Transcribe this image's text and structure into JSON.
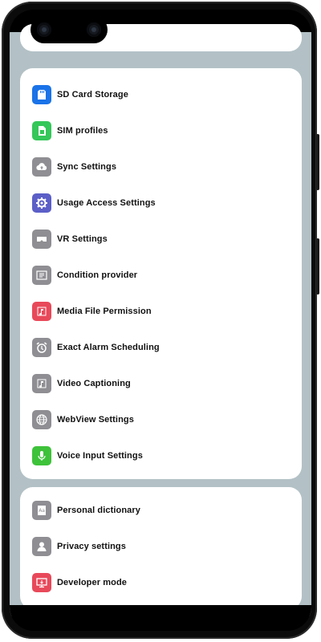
{
  "group1": {
    "items": [
      {
        "label": "SD Card Storage",
        "icon": "sd-card-icon",
        "color": "#1a73e8"
      },
      {
        "label": "SIM profiles",
        "icon": "sim-icon",
        "color": "#34c759"
      },
      {
        "label": "Sync Settings",
        "icon": "cloud-sync-icon",
        "color": "#8e8e93"
      },
      {
        "label": "Usage Access Settings",
        "icon": "gear-icon",
        "color": "#5b5fc7"
      },
      {
        "label": "VR Settings",
        "icon": "vr-headset-icon",
        "color": "#8e8e93"
      },
      {
        "label": "Condition provider",
        "icon": "condition-icon",
        "color": "#8e8e93"
      },
      {
        "label": "Media File Permission",
        "icon": "music-note-icon",
        "color": "#e8495a"
      },
      {
        "label": "Exact Alarm Scheduling",
        "icon": "alarm-clock-icon",
        "color": "#8e8e93"
      },
      {
        "label": "Video Captioning",
        "icon": "caption-icon",
        "color": "#8e8e93"
      },
      {
        "label": "WebView Settings",
        "icon": "globe-icon",
        "color": "#8e8e93"
      },
      {
        "label": "Voice Input Settings",
        "icon": "microphone-icon",
        "color": "#3ec23a"
      }
    ]
  },
  "group2": {
    "items": [
      {
        "label": "Personal dictionary",
        "icon": "dictionary-icon",
        "color": "#8e8e93"
      },
      {
        "label": "Privacy settings",
        "icon": "person-icon",
        "color": "#8e8e93"
      },
      {
        "label": "Developer mode",
        "icon": "developer-icon",
        "color": "#e8495a"
      }
    ]
  }
}
